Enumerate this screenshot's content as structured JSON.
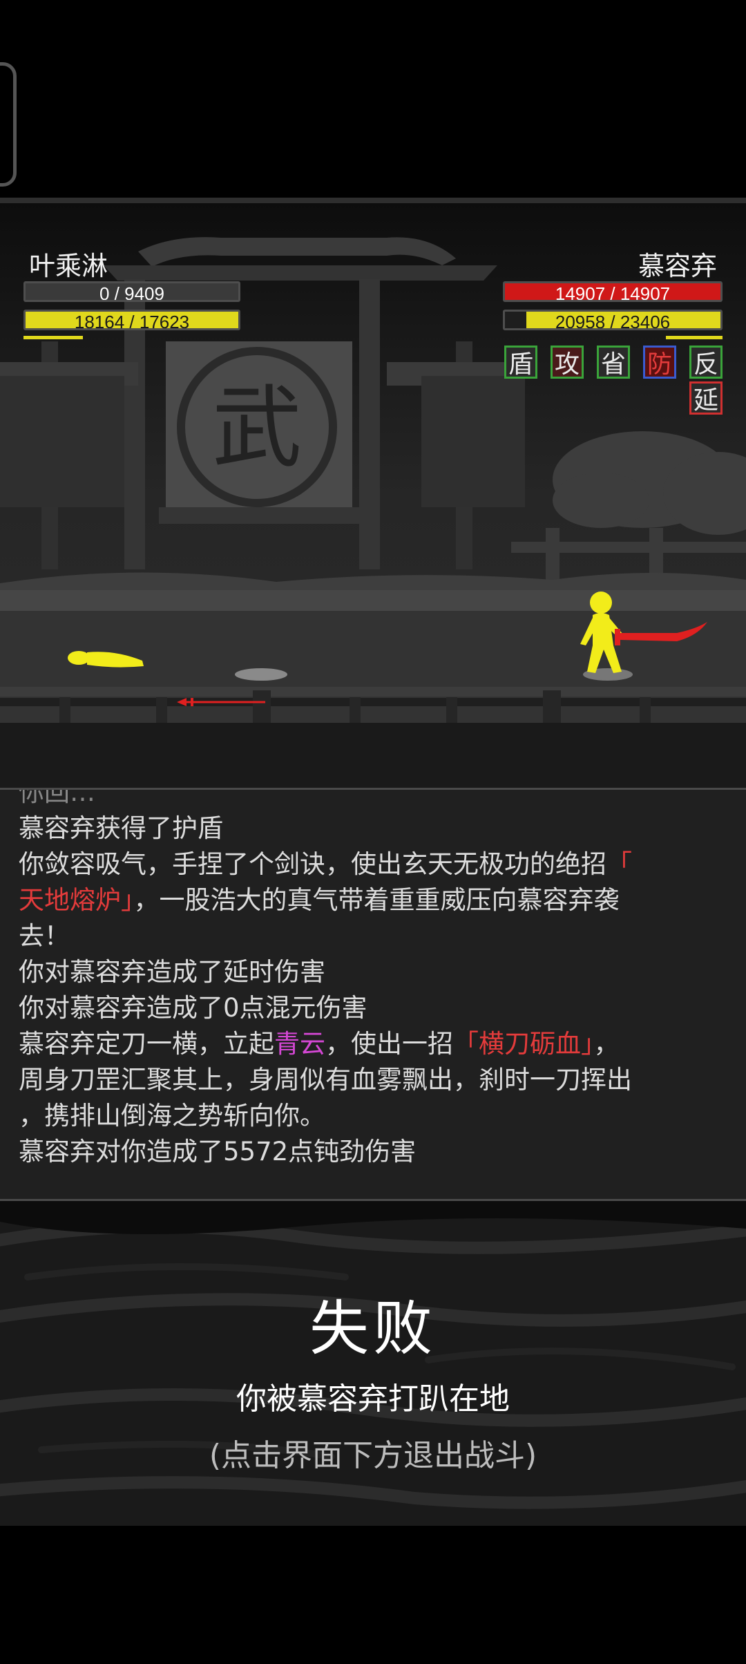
{
  "player": {
    "name": "叶乘淋",
    "hp": "0 / 9409",
    "hp_fraction": 0.0,
    "mp": "18164 / 17623",
    "mp_fraction": 1.0
  },
  "enemy": {
    "name": "慕容弃",
    "hp": "14907 / 14907",
    "hp_fraction": 1.0,
    "mp": "20958 / 23406",
    "mp_fraction": 0.9,
    "statuses": [
      {
        "label": "盾",
        "text_color": "#ffffff",
        "border": "#3aa43a"
      },
      {
        "label": "攻",
        "text_color": "#ffffff",
        "border": "#3aa43a"
      },
      {
        "label": "省",
        "text_color": "#ffffff",
        "border": "#3aa43a"
      },
      {
        "label": "防",
        "text_color": "#e33b3b",
        "border": "#3a5bd0"
      },
      {
        "label": "反",
        "text_color": "#ffffff",
        "border": "#3aa43a"
      },
      {
        "label": "延",
        "text_color": "#ffffff",
        "border": "#d03030"
      }
    ]
  },
  "scene": {
    "banner_glyph": "武"
  },
  "log": {
    "cut_line": "你回…",
    "l1": "慕容弃获得了护盾",
    "l2a": "你敛容吸气，手捏了个剑诀，使出玄天无极功的绝招",
    "l2b": "「",
    "l3a": "天地熔炉」",
    "l3b": "，一股浩大的真气带着重重威压向慕容弃袭",
    "l4": "去！",
    "l5": "你对慕容弃造成了延时伤害",
    "l6": "你对慕容弃造成了0点混元伤害",
    "l7a": "慕容弃定刀一横，立起",
    "l7b": "青云",
    "l7c": "，使出一招",
    "l7d": "「横刀砺血」",
    "l7e": "，",
    "l8": "周身刀罡汇聚其上，身周似有血雾飘出，刹时一刀挥出",
    "l9": "，携排山倒海之势斩向你。",
    "l10": "慕容弃对你造成了5572点钝劲伤害"
  },
  "result": {
    "title": "失败",
    "message": "你被慕容弃打趴在地",
    "hint": "(点击界面下方退出战斗)"
  },
  "colors": {
    "hp_red": "#d01818",
    "mp_yellow": "#e0d81c",
    "bar_bg": "#3a3a3a",
    "fighter_yellow": "#f2ec1a",
    "blade_red": "#e02020"
  }
}
